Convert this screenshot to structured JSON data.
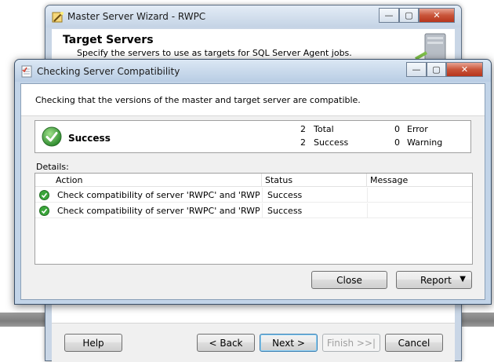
{
  "back_window": {
    "title": "Master Server Wizard - RWPC",
    "header_title": "Target Servers",
    "header_subtitle": "Specify the servers to use as targets for SQL Server Agent jobs.",
    "buttons": {
      "help": "Help",
      "back": "< Back",
      "next": "Next >",
      "finish": "Finish >>|",
      "cancel": "Cancel"
    }
  },
  "dialog": {
    "title": "Checking Server Compatibility",
    "header_text": "Checking that the versions of the master and target server are compatible.",
    "summary": {
      "status": "Success",
      "total_count": "2",
      "total_label": "Total",
      "success_count": "2",
      "success_label": "Success",
      "error_count": "0",
      "error_label": "Error",
      "warning_count": "0",
      "warning_label": "Warning"
    },
    "details_label": "Details:",
    "columns": [
      "Action",
      "Status",
      "Message"
    ],
    "rows": [
      {
        "action": "Check compatibility of server 'RWPC' and 'RWPC\\...",
        "status": "Success",
        "message": ""
      },
      {
        "action": "Check compatibility of server 'RWPC' and 'RWPC\\...",
        "status": "Success",
        "message": ""
      }
    ],
    "buttons": {
      "close": "Close",
      "report": "Report"
    }
  },
  "icons": {
    "app": "wizard-icon",
    "dialog": "check-list-icon",
    "success": "green-checkmark-icon",
    "report_dropdown": "triangle-down-icon"
  },
  "colors": {
    "success_green": "#3aa63a",
    "close_button_red": "#c9553a"
  }
}
